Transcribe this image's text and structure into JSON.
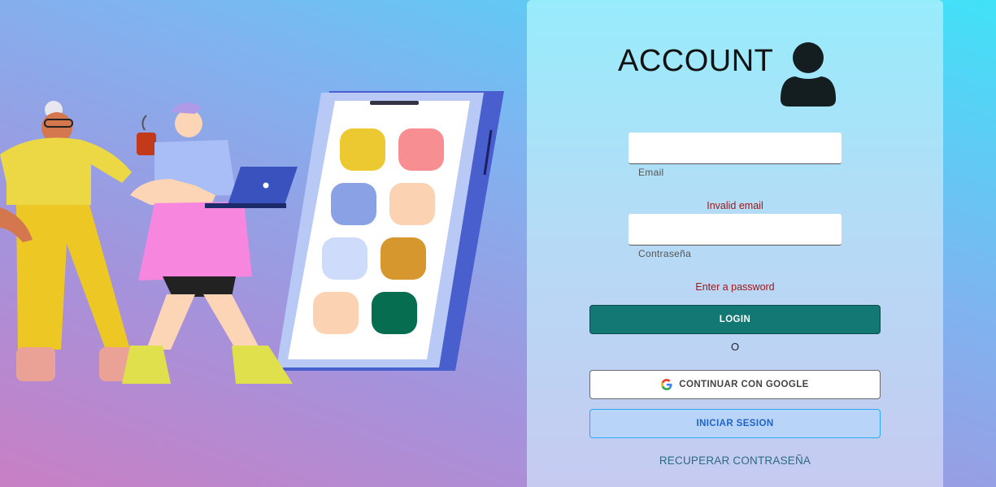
{
  "login": {
    "title": "ACCOUNT",
    "email_label": "Email",
    "email_value": "",
    "email_error": "Invalid email",
    "password_label": "Contraseña",
    "password_value": "",
    "password_error": "Enter a password",
    "login_button": "LOGIN",
    "separator": "O",
    "google_button": "CONTINUAR CON GOOGLE",
    "signin_button": "INICIAR SESION",
    "recover_link": "RECUPERAR CONTRASEÑA"
  },
  "icons": {
    "avatar": "user-icon",
    "google": "google-icon",
    "illustration": "people-with-phone-illustration"
  },
  "colors": {
    "login_button": "#137773",
    "signin_button_text": "#1e63c8",
    "error_text": "#a01818",
    "recover_link": "#2c6a85"
  }
}
